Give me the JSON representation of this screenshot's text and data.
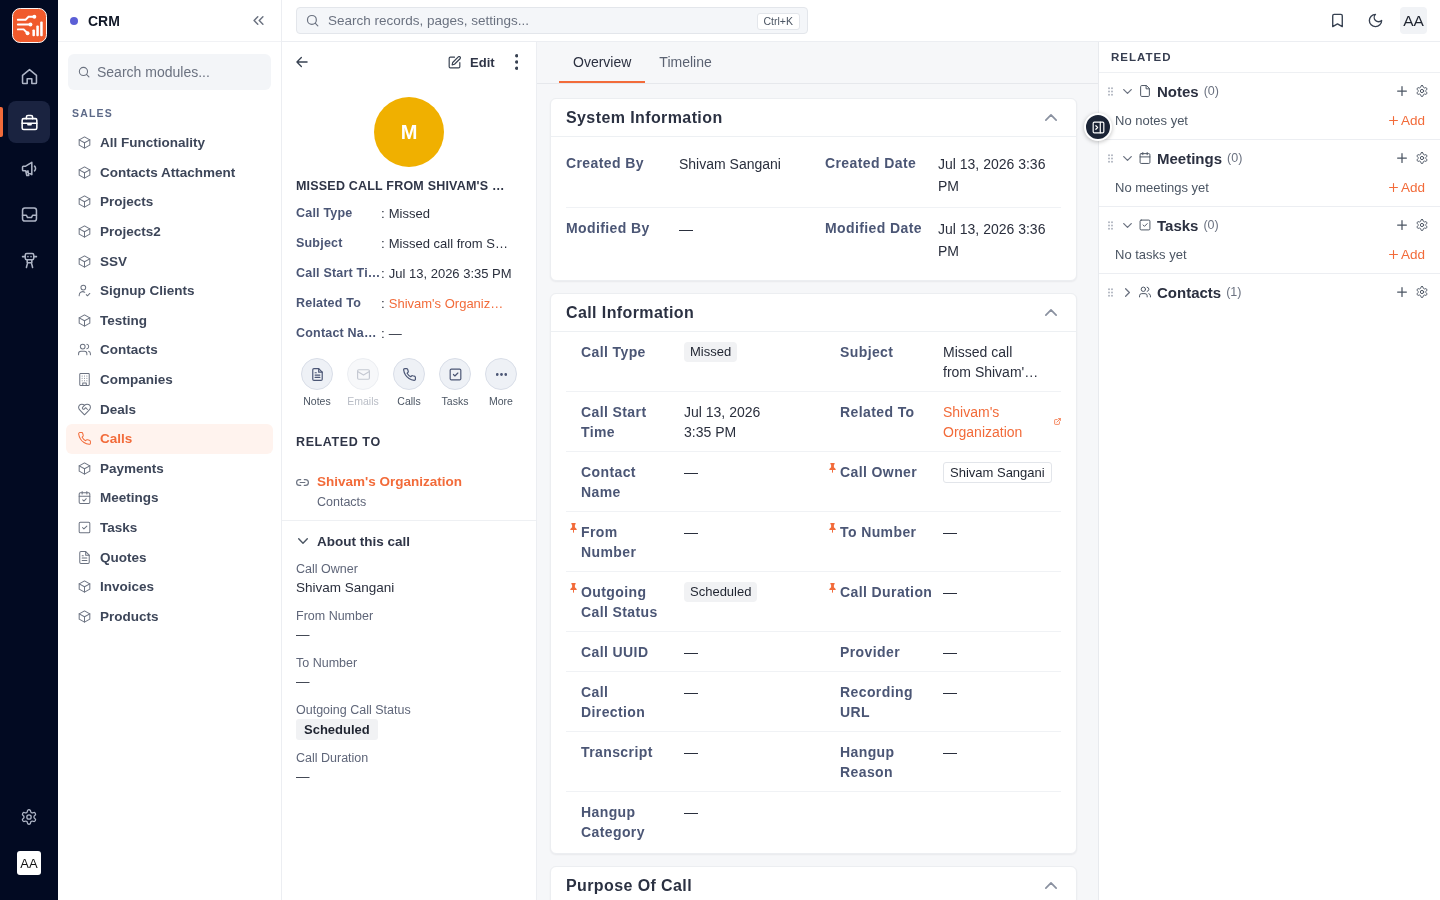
{
  "rail": {
    "items": [
      {
        "kind": "home",
        "selected": false
      },
      {
        "kind": "briefcase",
        "selected": true
      },
      {
        "kind": "megaphone",
        "selected": false
      },
      {
        "kind": "inbox",
        "selected": false
      },
      {
        "kind": "robot",
        "selected": false
      }
    ],
    "avatar": "AA"
  },
  "sidebar": {
    "title": "CRM",
    "search": {
      "placeholder": "Search modules..."
    },
    "section": "SALES",
    "items": [
      {
        "label": "All Functionality",
        "kind": "module",
        "selected": false
      },
      {
        "label": "Contacts Attachment",
        "kind": "module",
        "selected": false
      },
      {
        "label": "Projects",
        "kind": "module",
        "selected": false
      },
      {
        "label": "Projects2",
        "kind": "module",
        "selected": false
      },
      {
        "label": "SSV",
        "kind": "module",
        "selected": false
      },
      {
        "label": "Signup Clients",
        "kind": "person",
        "selected": false
      },
      {
        "label": "Testing",
        "kind": "module",
        "selected": false
      },
      {
        "label": "Contacts",
        "kind": "people",
        "selected": false
      },
      {
        "label": "Companies",
        "kind": "building",
        "selected": false
      },
      {
        "label": "Deals",
        "kind": "deal",
        "selected": false
      },
      {
        "label": "Calls",
        "kind": "phone",
        "selected": true
      },
      {
        "label": "Payments",
        "kind": "module",
        "selected": false
      },
      {
        "label": "Meetings",
        "kind": "calendar",
        "selected": false
      },
      {
        "label": "Tasks",
        "kind": "task",
        "selected": false
      },
      {
        "label": "Quotes",
        "kind": "document",
        "selected": false
      },
      {
        "label": "Invoices",
        "kind": "module",
        "selected": false
      },
      {
        "label": "Products",
        "kind": "module",
        "selected": false
      }
    ]
  },
  "topbar": {
    "search": {
      "placeholder": "Search records, pages, settings...",
      "shortcut": "Ctrl+K"
    },
    "avatar": "AA"
  },
  "record": {
    "edit": "Edit",
    "avatar": "M",
    "title": "MISSED CALL FROM SHIVAM'S …",
    "separator": ":",
    "fields": [
      {
        "label": "Call Type",
        "value": "Missed",
        "kind": "text"
      },
      {
        "label": "Subject",
        "value": "Missed call from S…",
        "kind": "text"
      },
      {
        "label": "Call Start Ti…",
        "value": "Jul 13, 2026 3:35 PM",
        "kind": "text"
      },
      {
        "label": "Related To",
        "value": "Shivam's Organiz…",
        "kind": "link"
      },
      {
        "label": "Contact Na…",
        "value": "—",
        "kind": "text"
      }
    ],
    "quick_actions": [
      {
        "label": "Notes",
        "kind": "notes",
        "disabled": false
      },
      {
        "label": "Emails",
        "kind": "email",
        "disabled": true
      },
      {
        "label": "Calls",
        "kind": "phone",
        "disabled": false
      },
      {
        "label": "Tasks",
        "kind": "task",
        "disabled": false
      },
      {
        "label": "More",
        "kind": "more",
        "disabled": false
      }
    ],
    "related_heading": "RELATED TO",
    "related": [
      {
        "name": "Shivam's Organization",
        "module": "Contacts"
      }
    ],
    "about": {
      "title": "About this call",
      "expanded": true,
      "fields": [
        {
          "label": "Call Owner",
          "value": "Shivam Sangani",
          "kind": "text"
        },
        {
          "label": "From Number",
          "value": "—",
          "kind": "text"
        },
        {
          "label": "To Number",
          "value": "—",
          "kind": "text"
        },
        {
          "label": "Outgoing Call Status",
          "value": "Scheduled",
          "kind": "badge"
        },
        {
          "label": "Call Duration",
          "value": "—",
          "kind": "text"
        }
      ]
    }
  },
  "tabs": [
    {
      "label": "Overview",
      "selected": true
    },
    {
      "label": "Timeline",
      "selected": false
    }
  ],
  "sections": [
    {
      "title": "System Information",
      "kind": "plain",
      "expanded": true,
      "rows": [
        {
          "fields": [
            {
              "label": "Created By",
              "value": "Shivam Sangani",
              "kind": "text"
            },
            {
              "label": "Created Date",
              "value": "Jul 13, 2026 3:36 PM",
              "kind": "text"
            }
          ]
        },
        {
          "fields": [
            {
              "label": "Modified By",
              "value": "—",
              "kind": "text"
            },
            {
              "label": "Modified Date",
              "value": "Jul 13, 2026 3:36 PM",
              "kind": "text"
            }
          ]
        }
      ]
    },
    {
      "title": "Call Information",
      "kind": "pinned",
      "expanded": true,
      "rows": [
        {
          "fields": [
            {
              "label": "Call Type",
              "value": "Missed",
              "kind": "badge",
              "required": false
            },
            {
              "label": "Subject",
              "value": "Missed call from Shivam'…",
              "kind": "text",
              "required": false
            }
          ]
        },
        {
          "fields": [
            {
              "label": "Call Start Time",
              "value": "Jul 13, 2026 3:35 PM",
              "kind": "text",
              "required": false
            },
            {
              "label": "Related To",
              "value": "Shivam's Organization",
              "kind": "link",
              "required": false
            }
          ]
        },
        {
          "fields": [
            {
              "label": "Contact Name",
              "value": "—",
              "kind": "text",
              "required": false
            },
            {
              "label": "Call Owner",
              "value": "Shivam Sangani",
              "kind": "chip",
              "required": true
            }
          ]
        },
        {
          "fields": [
            {
              "label": "From Number",
              "value": "—",
              "kind": "text",
              "required": true
            },
            {
              "label": "To Number",
              "value": "—",
              "kind": "text",
              "required": true
            }
          ]
        },
        {
          "fields": [
            {
              "label": "Outgoing Call Status",
              "value": "Scheduled",
              "kind": "badge",
              "required": true
            },
            {
              "label": "Call Duration",
              "value": "—",
              "kind": "text",
              "required": true
            }
          ]
        },
        {
          "fields": [
            {
              "label": "Call UUID",
              "value": "—",
              "kind": "text",
              "required": false
            },
            {
              "label": "Provider",
              "value": "—",
              "kind": "text",
              "required": false
            }
          ]
        },
        {
          "fields": [
            {
              "label": "Call Direction",
              "value": "—",
              "kind": "text",
              "required": false
            },
            {
              "label": "Recording URL",
              "value": "—",
              "kind": "text",
              "required": false
            }
          ]
        },
        {
          "fields": [
            {
              "label": "Transcript",
              "value": "—",
              "kind": "text",
              "required": false
            },
            {
              "label": "Hangup Reason",
              "value": "—",
              "kind": "text",
              "required": false
            }
          ]
        },
        {
          "fields": [
            {
              "label": "Hangup Category",
              "value": "—",
              "kind": "text",
              "required": false
            }
          ]
        }
      ]
    },
    {
      "title": "Purpose Of Call",
      "expanded": true
    }
  ],
  "related_panel": {
    "heading": "RELATED",
    "groups": [
      {
        "title": "Notes",
        "count": "(0)",
        "kind": "notes",
        "expanded": true,
        "empty": "No notes yet",
        "add": "Add"
      },
      {
        "title": "Meetings",
        "count": "(0)",
        "kind": "calendar",
        "expanded": true,
        "empty": "No meetings yet",
        "add": "Add"
      },
      {
        "title": "Tasks",
        "count": "(0)",
        "kind": "task",
        "expanded": true,
        "empty": "No tasks yet",
        "add": "Add"
      },
      {
        "title": "Contacts",
        "count": "(1)",
        "kind": "people",
        "expanded": false
      }
    ]
  }
}
